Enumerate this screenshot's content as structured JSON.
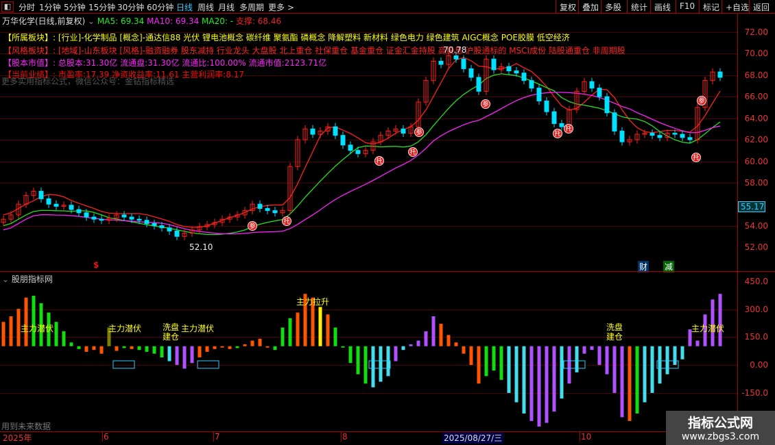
{
  "toolbar": {
    "periods": [
      "分时",
      "1分钟",
      "5分钟",
      "15分钟",
      "30分钟",
      "60分钟",
      "日线",
      "周线",
      "月线",
      "多周期",
      "更多 >"
    ],
    "active_period": "日线",
    "right_buttons": [
      "复权",
      "叠加",
      "多股",
      "统计",
      "画线",
      "F10",
      "标记",
      "+自选",
      "返回"
    ]
  },
  "title": {
    "name": "万华化学(日线,前复权)",
    "ma5": "MA5: 69.34",
    "ma10": "MA10: 69.34",
    "ma20": "MA20: -",
    "support": "支撑: 68.46"
  },
  "info": {
    "sector": "【所属板块】: [行业]-化学制品 [概念]-通达信88 光伏 锂电池概念 碳纤维 聚氨酯 磷概念 降解塑料 新材料 绿色电力 绿色建筑 AIGC概念 POE胶膜 低空经济",
    "style": "【风格板块】: [地域]-山东板块 [风格]-融资融券 股东减持 行业龙头 大盘股 北上重仓 社保重仓 基金重仓 证金汇金持股 高股息 沪股通标的 MSCI成份 陆股通重仓 非周期股",
    "cap": "【股本市值】: 总股本:31.30亿 流通盘:31.30亿 流通比:100.00% 流通市值:2123.71亿",
    "perf": "【当前业绩】: 市盈率:17.39 净资收益率:11.61 主营利润率:8.17",
    "promo": "更多实用指标公式，微信公众号：金钻指标精选"
  },
  "colors": {
    "up": "#ff2020",
    "down": "#00e0ff",
    "ma_short": "#ff2020",
    "ma_mid": "#20e020",
    "ma_long": "#ff20ff",
    "hist_o": "#ff5500",
    "hist_g": "#11dd11",
    "hist_c": "#44ddee",
    "hist_p": "#b050ff",
    "hist_y": "#ffee00",
    "hist_k": "#808000"
  },
  "price_axis": {
    "labels": [
      "72.00",
      "70.00",
      "68.00",
      "66.00",
      "64.00",
      "62.00",
      "60.00",
      "58.00",
      "54.00",
      "52.00"
    ],
    "current": "55.17",
    "high_mark": "70.78",
    "low_mark": "52.10"
  },
  "markers": {
    "can": "参",
    "tuo": "托",
    "dollar": "$",
    "cai": "财",
    "jian": "减"
  },
  "chart_data": [
    {
      "type": "candlestick",
      "ylim": [
        51,
        73
      ],
      "closes": [
        54.6,
        55.0,
        56.0,
        56.8,
        57.2,
        56.5,
        56.0,
        55.8,
        55.9,
        55.5,
        55.2,
        54.8,
        54.6,
        54.5,
        54.7,
        55.0,
        54.8,
        54.6,
        54.5,
        54.2,
        54.0,
        53.8,
        53.5,
        53.0,
        53.3,
        53.6,
        53.9,
        54.1,
        54.3,
        54.6,
        54.8,
        55.0,
        55.4,
        56.0,
        55.6,
        55.4,
        55.2,
        55.4,
        59.5,
        62.0,
        63.0,
        62.5,
        62.8,
        63.2,
        62.4,
        61.5,
        61.0,
        60.7,
        61.0,
        61.8,
        62.4,
        62.8,
        63.0,
        62.6,
        63.2,
        65.5,
        67.5,
        69.3,
        69.0,
        69.8,
        69.5,
        68.6,
        67.8,
        66.5,
        69.5,
        68.5,
        68.8,
        68.4,
        68.2,
        67.5,
        66.8,
        65.6,
        64.6,
        63.5,
        63.2,
        64.8,
        66.5,
        67.4,
        66.8,
        66.0,
        64.5,
        62.8,
        61.8,
        62.0,
        62.5,
        62.6,
        62.4,
        62.2,
        62.6,
        62.5,
        62.2,
        62.0,
        65.0,
        67.5,
        68.3,
        67.8
      ]
    },
    {
      "type": "bar",
      "title": "股朋指标网",
      "ylim": [
        -200,
        480
      ],
      "ticks": [
        "450.0",
        "300.0",
        "150.0",
        "0.00",
        "-150.0"
      ],
      "base": 100,
      "values": [
        230,
        260,
        300,
        360,
        370,
        330,
        280,
        230,
        180,
        120,
        85,
        70,
        80,
        60,
        200,
        75,
        90,
        85,
        80,
        70,
        60,
        40,
        20,
        0,
        -20,
        10,
        40,
        70,
        85,
        95,
        85,
        90,
        110,
        130,
        140,
        95,
        80,
        200,
        250,
        280,
        380,
        360,
        310,
        270,
        200,
        100,
        10,
        -50,
        -100,
        -120,
        -90,
        -60,
        20,
        80,
        110,
        130,
        180,
        260,
        220,
        160,
        120,
        60,
        0,
        -100,
        -60,
        -30,
        -80,
        -150,
        -200,
        -260,
        -300,
        -330,
        -310,
        -250,
        -180,
        -100,
        -40,
        60,
        80,
        0,
        -50,
        -150,
        -280,
        -300,
        -260,
        -200,
        -150,
        -100,
        -50,
        0,
        30,
        190,
        130,
        270,
        350,
        380
      ],
      "colors": "oooogggggggoookogoggggcpppooooogoooogggoooyogggggcccpcppppoooooogggcccppppcpcppppppogccccccpppppppokoooo",
      "annotations": [
        "主力潜伏",
        "主力潜伏",
        "洗盘\n建仓",
        "主力潜伏",
        "主力拉升",
        "洗盘\n建仓",
        "主力潜伏"
      ],
      "footer": "用到未来数据"
    }
  ],
  "time_axis": {
    "labels": [
      "2025年",
      "6",
      "7",
      "8",
      "10"
    ],
    "cursor_date": "2025/08/27/三"
  },
  "watermark": {
    "name": "指标公式网",
    "url": "www.zbgs3.com"
  }
}
